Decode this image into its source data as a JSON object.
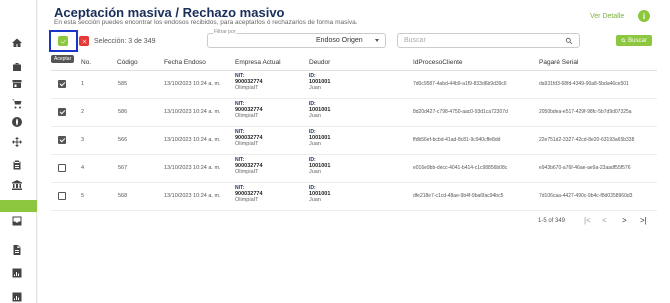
{
  "header": {
    "title": "Aceptación masiva / Rechazo masivo",
    "subtitle": "En esta sección puedes encontrar los endosos recibidos, para aceptarlos ó rechazarlos de forma masiva.",
    "ver_detalle": "Ver Detalle",
    "info_icon": "i"
  },
  "toolbar": {
    "accept_tooltip": "Aceptar",
    "selection": "Selección: 3 de 349",
    "filter_label": "Filtrar por",
    "filter_value": "Endoso Origen",
    "search_placeholder": "Buscar",
    "buscar_label": "Buscar"
  },
  "table": {
    "headers": [
      "No.",
      "Código",
      "Fecha Endoso",
      "Empresa Actual",
      "Deudor",
      "IdProcesoCliente",
      "Pagaré Serial"
    ],
    "rows": [
      {
        "checked": true,
        "no": "1",
        "codigo": "585",
        "fecha": "13/10/2023 10:24 a. m.",
        "nit_label": "NIT:",
        "nit": "900032774",
        "empresa": "OlimpiaIT",
        "id_label": "ID:",
        "id": "1001001",
        "deudor": "Juan",
        "proceso": "7d0c9587-4abd-44b9-a1f9-833d6b9d39c6",
        "pagare": "da931fd3-68fd-4349-90a8-5bda46ce501"
      },
      {
        "checked": true,
        "no": "2",
        "codigo": "586",
        "fecha": "13/10/2023 10:24 a. m.",
        "nit_label": "NIT:",
        "nit": "900032774",
        "empresa": "OlimpiaIT",
        "id_label": "ID:",
        "id": "1001001",
        "deudor": "Juan",
        "proceso": "8d20d427-c798-4750-aac0-93d1ca72307d",
        "pagare": "2050bdea-e517-429f-98fc-5b7d9d07325a"
      },
      {
        "checked": true,
        "no": "3",
        "codigo": "566",
        "fecha": "13/10/2023 10:24 a. m.",
        "nit_label": "NIT:",
        "nit": "900032774",
        "empresa": "OlimpiaIT",
        "id_label": "ID:",
        "id": "1001001",
        "deudor": "Juan",
        "proceso": "ffdb56ef-bcbd-41ad-8c81-9c940cffe8dd",
        "pagare": "22e751d2-3327-42cd-8e20-63193a65b338"
      },
      {
        "checked": false,
        "no": "4",
        "codigo": "567",
        "fecha": "13/10/2023 10:24 a. m.",
        "nit_label": "NIT:",
        "nit": "900032774",
        "empresa": "OlimpiaIT",
        "id_label": "ID:",
        "id": "1001001",
        "deudor": "Juan",
        "proceso": "e016e9bb-decc-4041-b414-c1c98856b08c",
        "pagare": "e943b670-a76f-46ae-ae9a-23aadf55f576"
      },
      {
        "checked": false,
        "no": "5",
        "codigo": "568",
        "fecha": "13/10/2023 10:24 a. m.",
        "nit_label": "NIT:",
        "nit": "900032774",
        "empresa": "OlimpiaIT",
        "id_label": "ID:",
        "id": "1001001",
        "deudor": "Juan",
        "proceso": "dfe218e7-c1cd-48ae-9b4f-9ba6fac94bc5",
        "pagare": "7d106caa-4427-490c-9b4c-f8d0358960d3"
      }
    ]
  },
  "pagination": {
    "info": "1-5 of 349",
    "first": "|<",
    "prev": "<",
    "next": ">",
    "last": ">|"
  },
  "sidebar": {
    "icons": [
      "home-icon",
      "briefcase-icon",
      "store-icon",
      "cart-icon",
      "globe-icon",
      "move-icon",
      "clipboard-icon",
      "bank-icon",
      "file-check-icon",
      "active-item",
      "inbox-icon",
      "document-icon",
      "chart-icon",
      "chart-2-icon"
    ]
  },
  "colors": {
    "accent": "#8dc63f",
    "title": "#1a2e5a",
    "reject": "#e53935",
    "focus": "#1a33c9"
  }
}
